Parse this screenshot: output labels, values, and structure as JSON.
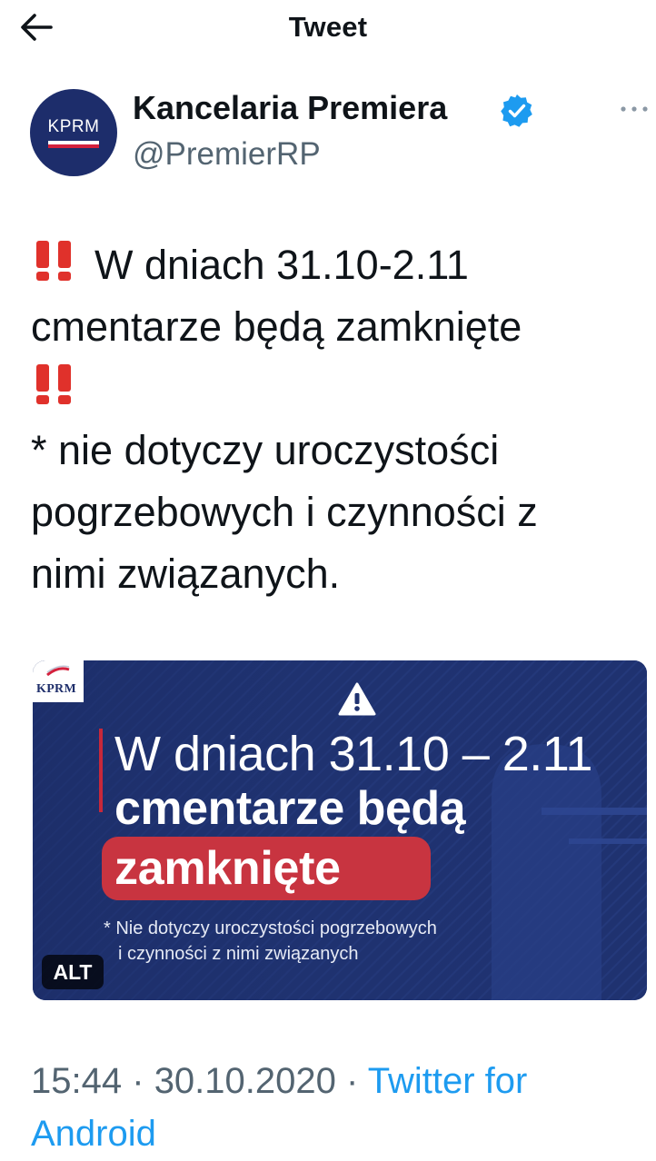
{
  "header": {
    "title": "Tweet",
    "back_icon": "arrow-left-icon"
  },
  "author": {
    "name": "Kancelaria Premiera",
    "handle": "@PremierRP",
    "avatar_text": "KPRM",
    "verified_icon": "verified-badge-icon",
    "more_icon": "more-horizontal-icon",
    "avatar_color": "#1d2d6b",
    "verified_color": "#1d9bf0"
  },
  "tweet": {
    "emoji_icon": "double-exclamation-icon",
    "line1": "W dniach 31.10-2.11",
    "line2": "cmentarze będą zamknięte",
    "line4": "* nie dotyczy uroczystości",
    "line5": "pogrzebowych i czynności z",
    "line6": "nimi związanych."
  },
  "media": {
    "logo": "KPRM",
    "warning_icon": "warning-triangle-icon",
    "line1": "W dniach 31.10 – 2.11",
    "line2": "cmentarze będą",
    "line3": "zamknięte",
    "note_line1": "* Nie dotyczy uroczystości pogrzebowych",
    "note_line2": "i czynności z nimi związanych",
    "alt_badge": "ALT",
    "background_color": "#1f3270",
    "accent_color": "#c83440"
  },
  "meta": {
    "time": "15:44",
    "separator": "·",
    "date": "30.10.2020",
    "source_line1": "Twitter for",
    "source_line2": "Android",
    "link_color": "#1d9bf0"
  }
}
